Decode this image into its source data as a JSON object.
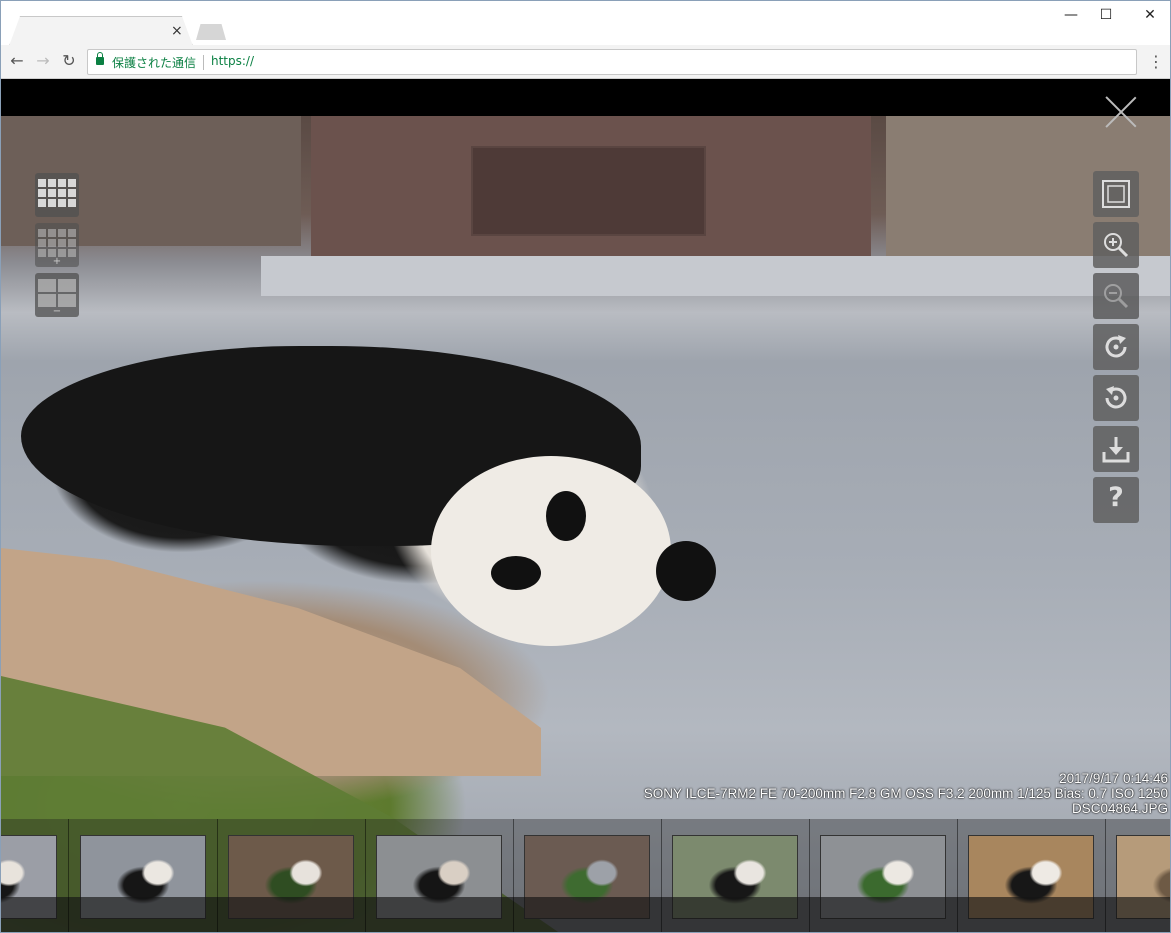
{
  "browser": {
    "tab_close_glyph": "×",
    "window_controls": {
      "minimize": "—",
      "maximize": "☐",
      "close": "✕"
    },
    "secure_label": "保護された通信",
    "url": "https://",
    "nav": {
      "back": "←",
      "forward": "→",
      "reload": "↻",
      "menu": "⋮"
    }
  },
  "viewer": {
    "exif": {
      "datetime": "2017/9/17 0:14:46",
      "camera": "SONY ILCE-7RM2 FE 70-200mm F2.8 GM OSS F3.2 200mm 1/125 Bias: 0.7 ISO 1250",
      "filename": "DSC04864.JPG"
    },
    "left_tools": [
      {
        "name": "grid-view-button",
        "icon": "grid-icon",
        "label": ""
      },
      {
        "name": "grid-enlarge-button",
        "icon": "grid-plus-icon",
        "label": "+"
      },
      {
        "name": "grid-shrink-button",
        "icon": "grid-minus-icon",
        "label": "−"
      }
    ],
    "right_tools": [
      {
        "name": "fit-screen-button",
        "icon": "fit-screen-icon"
      },
      {
        "name": "zoom-in-button",
        "icon": "zoom-in-icon"
      },
      {
        "name": "zoom-out-button",
        "icon": "zoom-out-icon"
      },
      {
        "name": "rotate-right-button",
        "icon": "rotate-right-icon"
      },
      {
        "name": "rotate-left-button",
        "icon": "rotate-left-icon"
      },
      {
        "name": "download-button",
        "icon": "download-icon"
      },
      {
        "name": "help-button",
        "icon": "help-icon",
        "label": "?"
      }
    ],
    "thumbnails": [
      {
        "colors": [
          "#9b9ea6",
          "#161616",
          "#e8e3dc"
        ]
      },
      {
        "colors": [
          "#8f949c",
          "#161616",
          "#ebe7e1"
        ]
      },
      {
        "colors": [
          "#6d5a4a",
          "#2f4d22",
          "#e7e2dc"
        ]
      },
      {
        "colors": [
          "#8c8f92",
          "#151515",
          "#d9cfc4"
        ]
      },
      {
        "colors": [
          "#6b5b52",
          "#3e6b30",
          "#9da1a8"
        ]
      },
      {
        "colors": [
          "#7c8a6e",
          "#171717",
          "#e9e5e0"
        ]
      },
      {
        "colors": [
          "#8e9195",
          "#3b6a2e",
          "#ece8e2"
        ]
      },
      {
        "colors": [
          "#a8865e",
          "#171717",
          "#eeeae4"
        ]
      },
      {
        "colors": [
          "#b69b7a",
          "#6e5a45",
          "#efebe6"
        ]
      }
    ]
  }
}
